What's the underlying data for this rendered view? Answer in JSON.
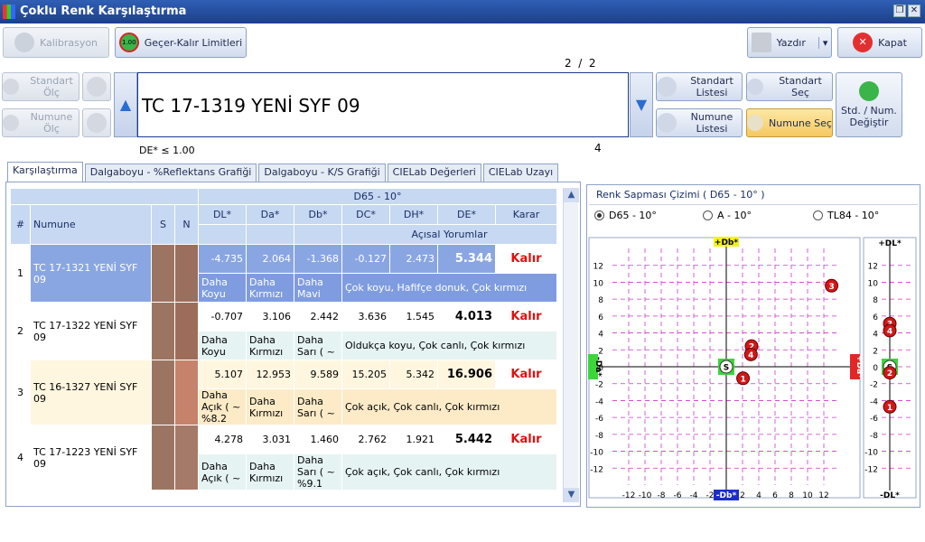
{
  "window": {
    "title": "Çoklu Renk Karşılaştırma",
    "restore": "❐",
    "close": "✕"
  },
  "toolbar": {
    "calibration": "Kalibrasyon",
    "pass_fail": "Geçer-Kalır Limitleri",
    "pass_fail_badge": "1.00",
    "print": "Yazdır",
    "print_arrow": "▾",
    "close": "Kapat"
  },
  "left_buttons": {
    "standard_measure": "Standart Ölç",
    "sample_measure": "Numune Ölç"
  },
  "nav": {
    "up": "▲",
    "down": "▼",
    "page": "2  /  2",
    "current_code": "TC 17-1319  YENİ SYF 09",
    "tolerance": "DE* ≤ 1.00",
    "count": "4"
  },
  "right_buttons": {
    "standard_list": "Standart Listesi",
    "sample_list": "Numune Listesi",
    "standard_select": "Standart Seç",
    "sample_select": "Numune Seç",
    "swap": "Std. / Num. Değiştir"
  },
  "tabs": [
    "Karşılaştırma",
    "Dalgaboyu - %Reflektans Grafiği",
    "Dalgaboyu - K/S Grafiği",
    "CIELab Değerleri",
    "CIELab Uzayı"
  ],
  "table": {
    "illuminant": "D65 - 10°",
    "headers": {
      "num": "#",
      "sample": "Numune",
      "s": "S",
      "n": "N",
      "dl": "DL*",
      "da": "Da*",
      "db": "Db*",
      "dc": "DC*",
      "dh": "DH*",
      "de": "DE*",
      "karar": "Karar",
      "comments": "Açısal Yorumlar"
    },
    "rows": [
      {
        "idx": "1",
        "name": "TC 17-1321  YENİ SYF 09",
        "s_color": "#9c7562",
        "n_color": "#9a6f5e",
        "dl": "-4.735",
        "da": "2.064",
        "db": "-1.368",
        "dc": "-0.127",
        "dh": "2.473",
        "de": "5.344",
        "karar": "Kalır",
        "t_dl": "Daha Koyu",
        "t_da": "Daha Kırmızı",
        "t_db": "Daha Mavi",
        "comment": "Çok koyu, Hafifçe donuk, Çok kırmızı"
      },
      {
        "idx": "2",
        "name": "TC 17-1322  YENİ SYF 09",
        "s_color": "#9c7562",
        "n_color": "#9e6d5a",
        "dl": "-0.707",
        "da": "3.106",
        "db": "2.442",
        "dc": "3.636",
        "dh": "1.545",
        "de": "4.013",
        "karar": "Kalır",
        "t_dl": "Daha Koyu",
        "t_da": "Daha Kırmızı",
        "t_db": "Daha Sarı ( ~",
        "comment": "Oldukça koyu, Çok canlı, Çok kırmızı"
      },
      {
        "idx": "3",
        "name": "TC 16-1327  YENİ SYF 09",
        "s_color": "#9c7562",
        "n_color": "#c6826a",
        "dl": "5.107",
        "da": "12.953",
        "db": "9.589",
        "dc": "15.205",
        "dh": "5.342",
        "de": "16.906",
        "karar": "Kalır",
        "t_dl": "Daha Açık ( ~ %8.2",
        "t_da": "Daha Kırmızı",
        "t_db": "Daha Sarı ( ~",
        "comment": "Çok açık, Çok canlı, Çok kırmızı"
      },
      {
        "idx": "4",
        "name": "TC 17-1223  YENİ SYF 09",
        "s_color": "#9c7562",
        "n_color": "#a67a68",
        "dl": "4.278",
        "da": "3.031",
        "db": "1.460",
        "dc": "2.762",
        "dh": "1.921",
        "de": "5.442",
        "karar": "Kalır",
        "t_dl": "Daha Açık ( ~",
        "t_da": "Daha Kırmızı",
        "t_db": "Daha Sarı ( ~ %9.1",
        "comment": "Çok açık, Çok canlı, Çok kırmızı"
      }
    ]
  },
  "chart": {
    "panel_title": "Renk Sapması Çizimi ( D65 - 10° )",
    "illuminants": [
      "D65 - 10°",
      "A - 10°",
      "TL84 - 10°"
    ],
    "selected": "D65 - 10°",
    "axis_labels": {
      "top": "+Db*",
      "bottom": "-Db*",
      "left": "-Da*",
      "right": "+Da*",
      "l_top": "+DL*",
      "l_bottom": "-DL*"
    },
    "ticks": [
      "12",
      "10",
      "8",
      "6",
      "4",
      "2",
      "0",
      "-2",
      "-4",
      "-6",
      "-8",
      "-10",
      "-12"
    ],
    "x_ticks": [
      "-12",
      "-10",
      "-8",
      "-6",
      "-4",
      "-2",
      "0",
      "2",
      "4",
      "6",
      "8",
      "10",
      "12"
    ],
    "standard_marker": "S",
    "points": [
      {
        "label": "1",
        "da": 2.064,
        "db": -1.368,
        "dl": -4.735
      },
      {
        "label": "2",
        "da": 3.106,
        "db": 2.442,
        "dl": -0.707
      },
      {
        "label": "3",
        "da": 12.953,
        "db": 9.589,
        "dl": 5.107
      },
      {
        "label": "4",
        "da": 3.031,
        "db": 1.46,
        "dl": 4.278
      }
    ]
  }
}
